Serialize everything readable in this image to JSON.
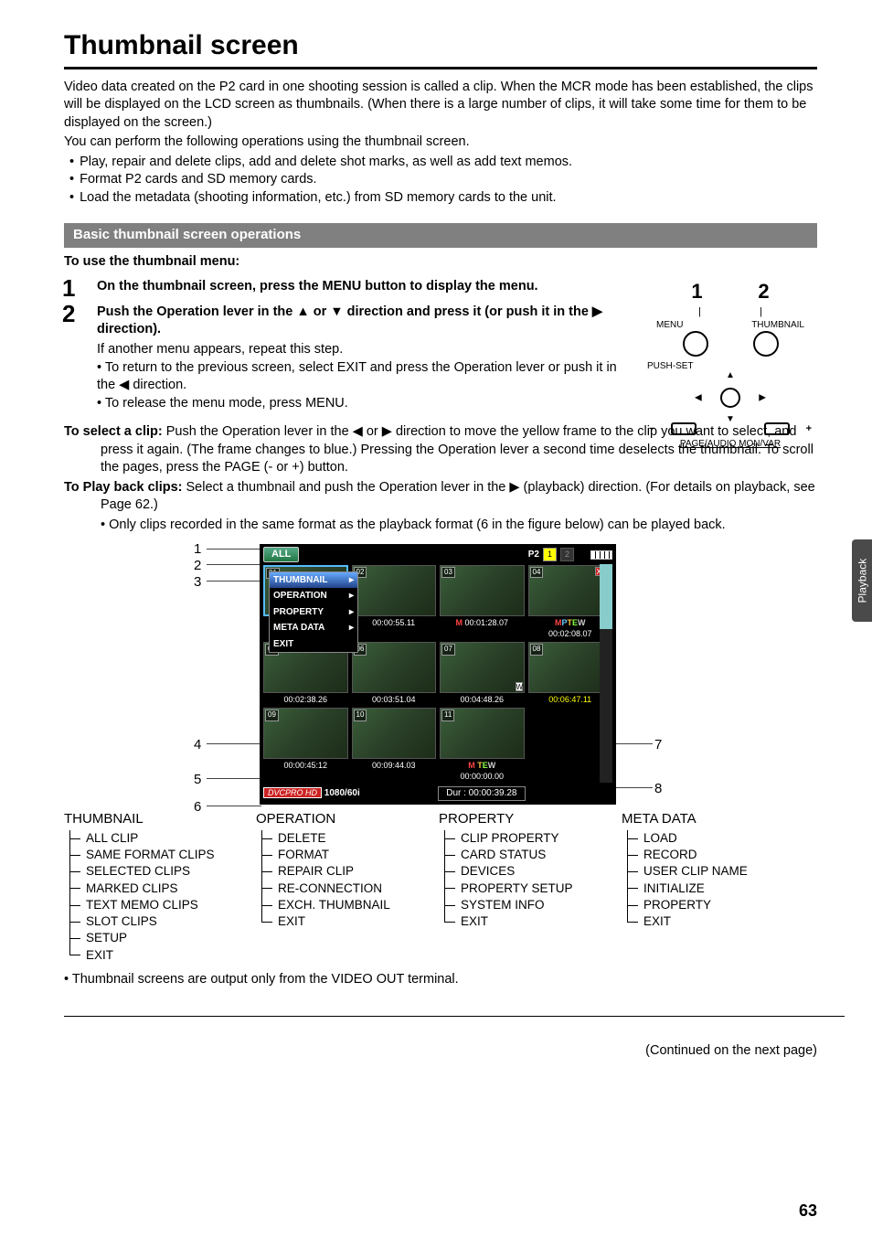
{
  "page": {
    "title": "Thumbnail screen",
    "intro1": "Video data created on the P2 card in one shooting session is called a clip. When the MCR mode has been established, the clips will be displayed on the LCD screen as thumbnails. (When there is a large number of clips, it will take some time for them to be displayed on the screen.)",
    "intro2": "You can perform the following operations using the thumbnail screen.",
    "bul1": "Play, repair and delete clips, add and delete shot marks, as well as add text memos.",
    "bul2": "Format P2 cards and SD memory cards.",
    "bul3": "Load the metadata (shooting information, etc.) from SD memory cards to the unit.",
    "section_bar": "Basic thumbnail screen operations",
    "sub_header": "To use the thumbnail menu:",
    "step1": "On the thumbnail screen, press the MENU button to display the menu.",
    "step2_a": "Push the Operation lever in the ▲ or ▼ direction and press it (or push it in the ▶ direction).",
    "step2_b": "If another menu appears, repeat this step.",
    "step2_b1": "To return to the previous screen, select EXIT and press the Operation lever or push it in the ◀ direction.",
    "step2_b2": "To release the menu mode, press MENU.",
    "select_label": "To select a clip:",
    "select_body": " Push the Operation lever in the ◀ or ▶ direction to move the yellow frame to the clip you want to select, and press it again. (The frame changes to blue.) Pressing the Operation lever a second time deselects the thumbnail. To scroll the pages, press the PAGE (- or +) button.",
    "play_label": "To Play back clips:",
    "play_body": " Select a thumbnail and push the Operation lever in the ▶ (playback) direction. (For details on playback, see Page 62.)",
    "play_note": "Only clips recorded in the same format as the playback format (6 in the figure below) can be played back.",
    "foot_note": "Thumbnail screens are output only from the VIDEO OUT terminal.",
    "continued": "(Continued on the next page)",
    "page_num": "63",
    "side_tab": "Playback"
  },
  "diagram": {
    "n1": "1",
    "n2": "2",
    "lbl_menu": "MENU",
    "lbl_thumb": "THUMBNAIL",
    "push_set": "PUSH-SET",
    "footer": "PAGE/AUDIO MON/VAR",
    "minus": "−",
    "plus": "+"
  },
  "screenshot": {
    "callouts_left": [
      "1",
      "2",
      "3",
      "4",
      "5",
      "6"
    ],
    "callouts_right": [
      "7",
      "8"
    ],
    "top_all": "ALL",
    "top_p2": "P2",
    "top_slot1": "1",
    "top_slot2": "2",
    "menu_header": "THUMBNAIL",
    "menu_items": [
      "OPERATION",
      "PROPERTY",
      "META DATA",
      "EXIT"
    ],
    "cell_nums": [
      "01",
      "02",
      "03",
      "04",
      "05",
      "06",
      "07",
      "08",
      "09",
      "10",
      "11"
    ],
    "row1_tc": [
      "",
      "00:00:55.11",
      "00:01:28.07",
      "00:02:08.07"
    ],
    "row2_tc": [
      "00:02:38.26",
      "00:03:51.04",
      "00:04:48.26",
      "00:06:47.11"
    ],
    "row3_tc": [
      "00:00:45:12",
      "00:09:44.03",
      "00:00:00.00",
      ""
    ],
    "cell4_ind": [
      "M",
      "P",
      "T",
      "E",
      "W"
    ],
    "cell3_ind": "M",
    "cell7_ind": "W",
    "cell11_ind": [
      "M",
      "T",
      "E",
      "W"
    ],
    "cell4_x": "X",
    "cell4_ex": "!",
    "fmt_badge": "DVCPRO HD",
    "fmt_text": "1080/60i",
    "dur": "Dur : 00:00:39.28"
  },
  "tree": {
    "c1_head": "THUMBNAIL",
    "c1": [
      "ALL CLIP",
      "SAME FORMAT CLIPS",
      "SELECTED CLIPS",
      "MARKED CLIPS",
      "TEXT MEMO CLIPS",
      "SLOT CLIPS",
      "SETUP",
      "EXIT"
    ],
    "c2_head": "OPERATION",
    "c2": [
      "DELETE",
      "FORMAT",
      "REPAIR CLIP",
      "RE-CONNECTION",
      "EXCH. THUMBNAIL",
      "EXIT"
    ],
    "c3_head": "PROPERTY",
    "c3": [
      "CLIP PROPERTY",
      "CARD STATUS",
      "DEVICES",
      "PROPERTY SETUP",
      "SYSTEM INFO",
      "EXIT"
    ],
    "c4_head": "META DATA",
    "c4": [
      "LOAD",
      "RECORD",
      "USER CLIP NAME",
      "INITIALIZE",
      "PROPERTY",
      "EXIT"
    ]
  }
}
